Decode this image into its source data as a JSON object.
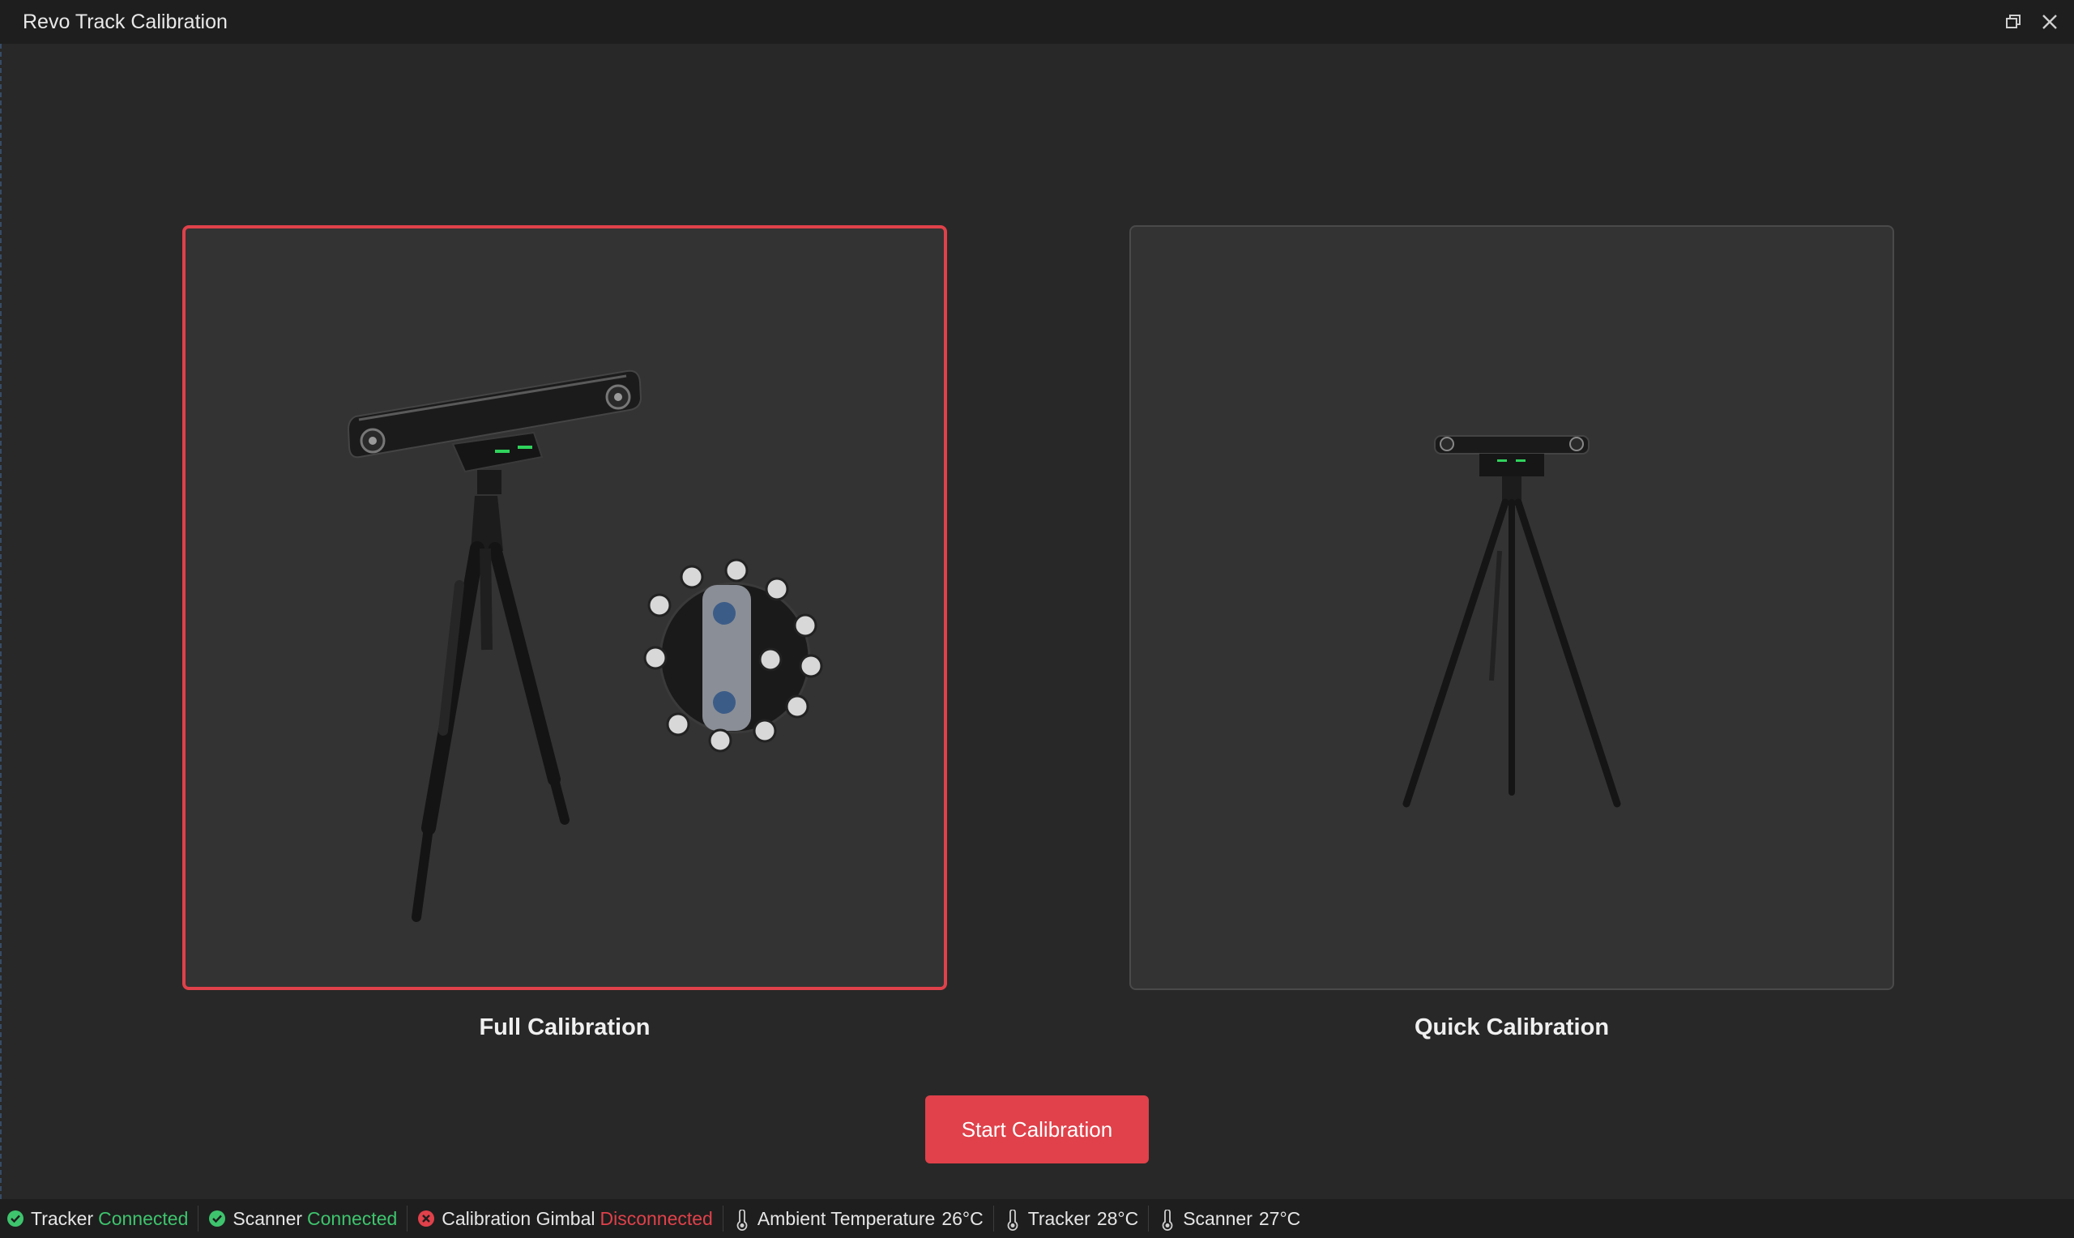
{
  "window": {
    "title": "Revo Track Calibration",
    "controls": [
      "restore-icon",
      "close-icon"
    ]
  },
  "options": {
    "full": {
      "label": "Full Calibration",
      "selected": true
    },
    "quick": {
      "label": "Quick Calibration",
      "selected": false
    }
  },
  "start_button": {
    "label": "Start Calibration"
  },
  "status": {
    "tracker": {
      "name": "Tracker",
      "state": "Connected",
      "icon": "check-circle-icon"
    },
    "scanner": {
      "name": "Scanner",
      "state": "Connected",
      "icon": "check-circle-icon"
    },
    "gimbal": {
      "name": "Calibration Gimbal",
      "state": "Disconnected",
      "icon": "error-circle-icon"
    },
    "ambient_temp": {
      "name": "Ambient Temperature",
      "value": "26°C",
      "icon": "thermometer-icon"
    },
    "tracker_temp": {
      "name": "Tracker",
      "value": "28°C",
      "icon": "thermometer-icon"
    },
    "scanner_temp": {
      "name": "Scanner",
      "value": "27°C",
      "icon": "thermometer-icon"
    }
  },
  "colors": {
    "accent": "#e0414a",
    "ok": "#3ec46d",
    "background": "#282828",
    "bar": "#1e1e1e"
  }
}
